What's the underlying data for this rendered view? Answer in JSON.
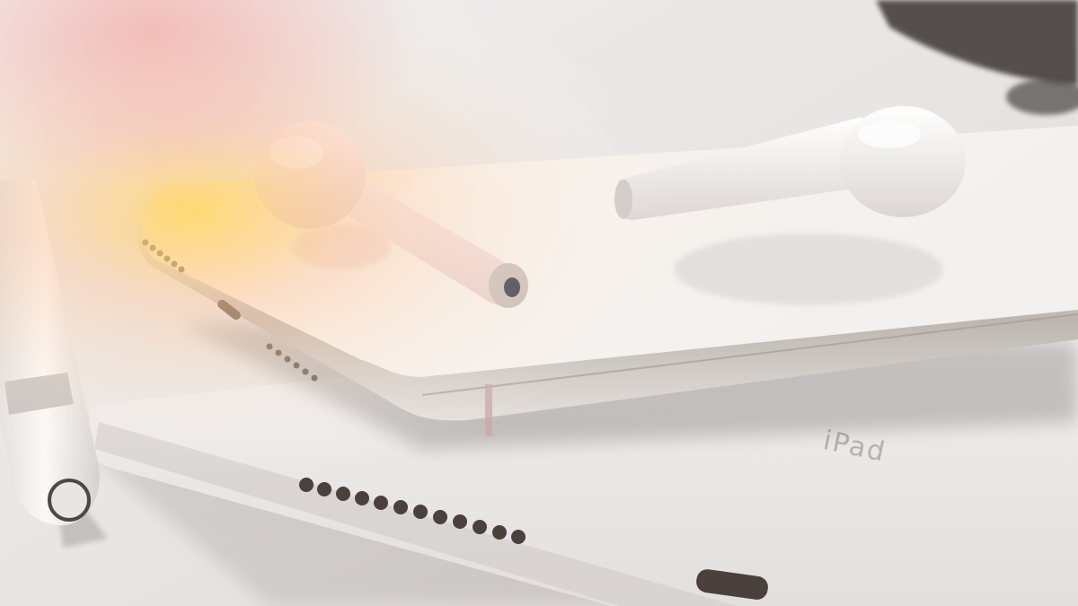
{
  "scene": {
    "description_free": true,
    "engraved_text": "iPad",
    "palette": {
      "background": "#ece9e7",
      "tablet_silver": "#f2f1f0",
      "tablet_edge": "#c9c5c2",
      "phone_glass": "#f7f5f3",
      "phone_edge": "#d8d2cc",
      "earbud_white": "#f6f4f3",
      "shadow": "#6f6a67",
      "warm_glow": "#ffcf5a",
      "pink_glow": "#f3b2b0",
      "port_dark": "#4a403c"
    }
  }
}
